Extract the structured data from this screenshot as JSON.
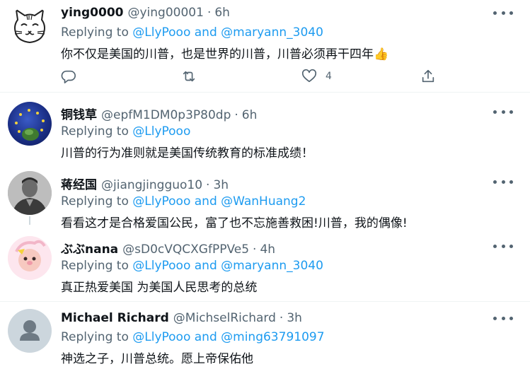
{
  "tweets": [
    {
      "name": "ying0000",
      "handle": "@ying00001",
      "sep": "·",
      "time": "6h",
      "replying_prefix": "Replying to ",
      "replying_links": "@LlyPooo and @maryann_3040",
      "text": "你不仅是美国的川普，也是世界的川普，川普必须再干四年",
      "emoji": "👍",
      "like_count": "4"
    },
    {
      "name": "铜钱草",
      "handle": "@epfM1DM0p3P80dp",
      "sep": "·",
      "time": "6h",
      "replying_prefix": "Replying to ",
      "replying_links": "@LlyPooo",
      "text": "川普的行为准则就是美国传统教育的标准成绩！"
    },
    {
      "name": "蒋经国",
      "handle": "@jiangjingguo10",
      "sep": "·",
      "time": "3h",
      "replying_prefix": "Replying to ",
      "replying_links": "@LlyPooo and @WanHuang2",
      "text": "看看这才是合格爱国公民，富了也不忘施善救困!川普，我的偶像!"
    },
    {
      "name": "ぶぶnana",
      "handle": "@sD0cVQCXGfPPVe5",
      "sep": "·",
      "time": "4h",
      "replying_prefix": "Replying to ",
      "replying_links": "@LlyPooo and @maryann_3040",
      "text": "真正热爱美国 为美国人民思考的总统"
    },
    {
      "name": "Michael Richard",
      "handle": "@MichselRichard",
      "sep": "·",
      "time": "3h",
      "replying_prefix": "Replying to ",
      "replying_links": "@LlyPooo and @ming63791097",
      "text": "神选之子，川普总统。愿上帝保佑他"
    }
  ],
  "colors": {
    "text": "#0f1419",
    "secondary": "#536471",
    "link": "#1d9bf0",
    "divider": "#eff3f4",
    "thread_line": "#cfd9de"
  },
  "icons": [
    "reply-icon",
    "retweet-icon",
    "like-icon",
    "share-icon",
    "more-icon"
  ]
}
